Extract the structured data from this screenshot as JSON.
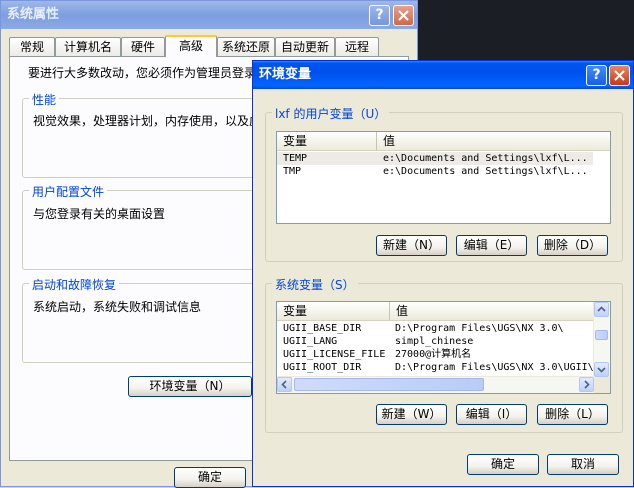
{
  "sysprops": {
    "title": "系统属性",
    "tabs": [
      "常规",
      "计算机名",
      "硬件",
      "高级",
      "系统还原",
      "自动更新",
      "远程"
    ],
    "active_tab": "高级",
    "intro": "要进行大多数改动，您必须作为管理员登录",
    "perf": {
      "title": "性能",
      "desc": "视觉效果，处理器计划，内存使用，以及虚"
    },
    "profile": {
      "title": "用户配置文件",
      "desc": "与您登录有关的桌面设置"
    },
    "startup": {
      "title": "启动和故障恢复",
      "desc": "系统启动，系统失败和调试信息"
    },
    "env_button": "环境变量（N）",
    "ok_button": "确定"
  },
  "envvars": {
    "title": "环境变量",
    "user_group_label": "lxf 的用户变量（U）",
    "columns": {
      "name": "变量",
      "value": "值"
    },
    "user_vars": [
      {
        "name": "TEMP",
        "value": "e:\\Documents and Settings\\lxf\\L..."
      },
      {
        "name": "TMP",
        "value": "e:\\Documents and Settings\\lxf\\L..."
      }
    ],
    "user_buttons": {
      "new": "新建（N）",
      "edit": "编辑（E）",
      "delete": "删除（D）"
    },
    "sys_group_label": "系统变量（S）",
    "sys_vars": [
      {
        "name": "UGII_BASE_DIR",
        "value": "D:\\Program Files\\UGS\\NX 3.0\\"
      },
      {
        "name": "UGII_LANG",
        "value": "simpl_chinese"
      },
      {
        "name": "UGII_LICENSE_FILE",
        "value": "27000@计算机名"
      },
      {
        "name": "UGII_ROOT_DIR",
        "value": "D:\\Program Files\\UGS\\NX 3.0\\UGII\\"
      }
    ],
    "sys_buttons": {
      "new": "新建（W）",
      "edit": "编辑（I）",
      "delete": "删除（L）"
    },
    "ok_button": "确定",
    "cancel_button": "取消"
  },
  "icons": [
    "help-icon",
    "close-icon",
    "arrow-up-icon",
    "arrow-down-icon",
    "arrow-left-icon",
    "arrow-right-icon"
  ]
}
